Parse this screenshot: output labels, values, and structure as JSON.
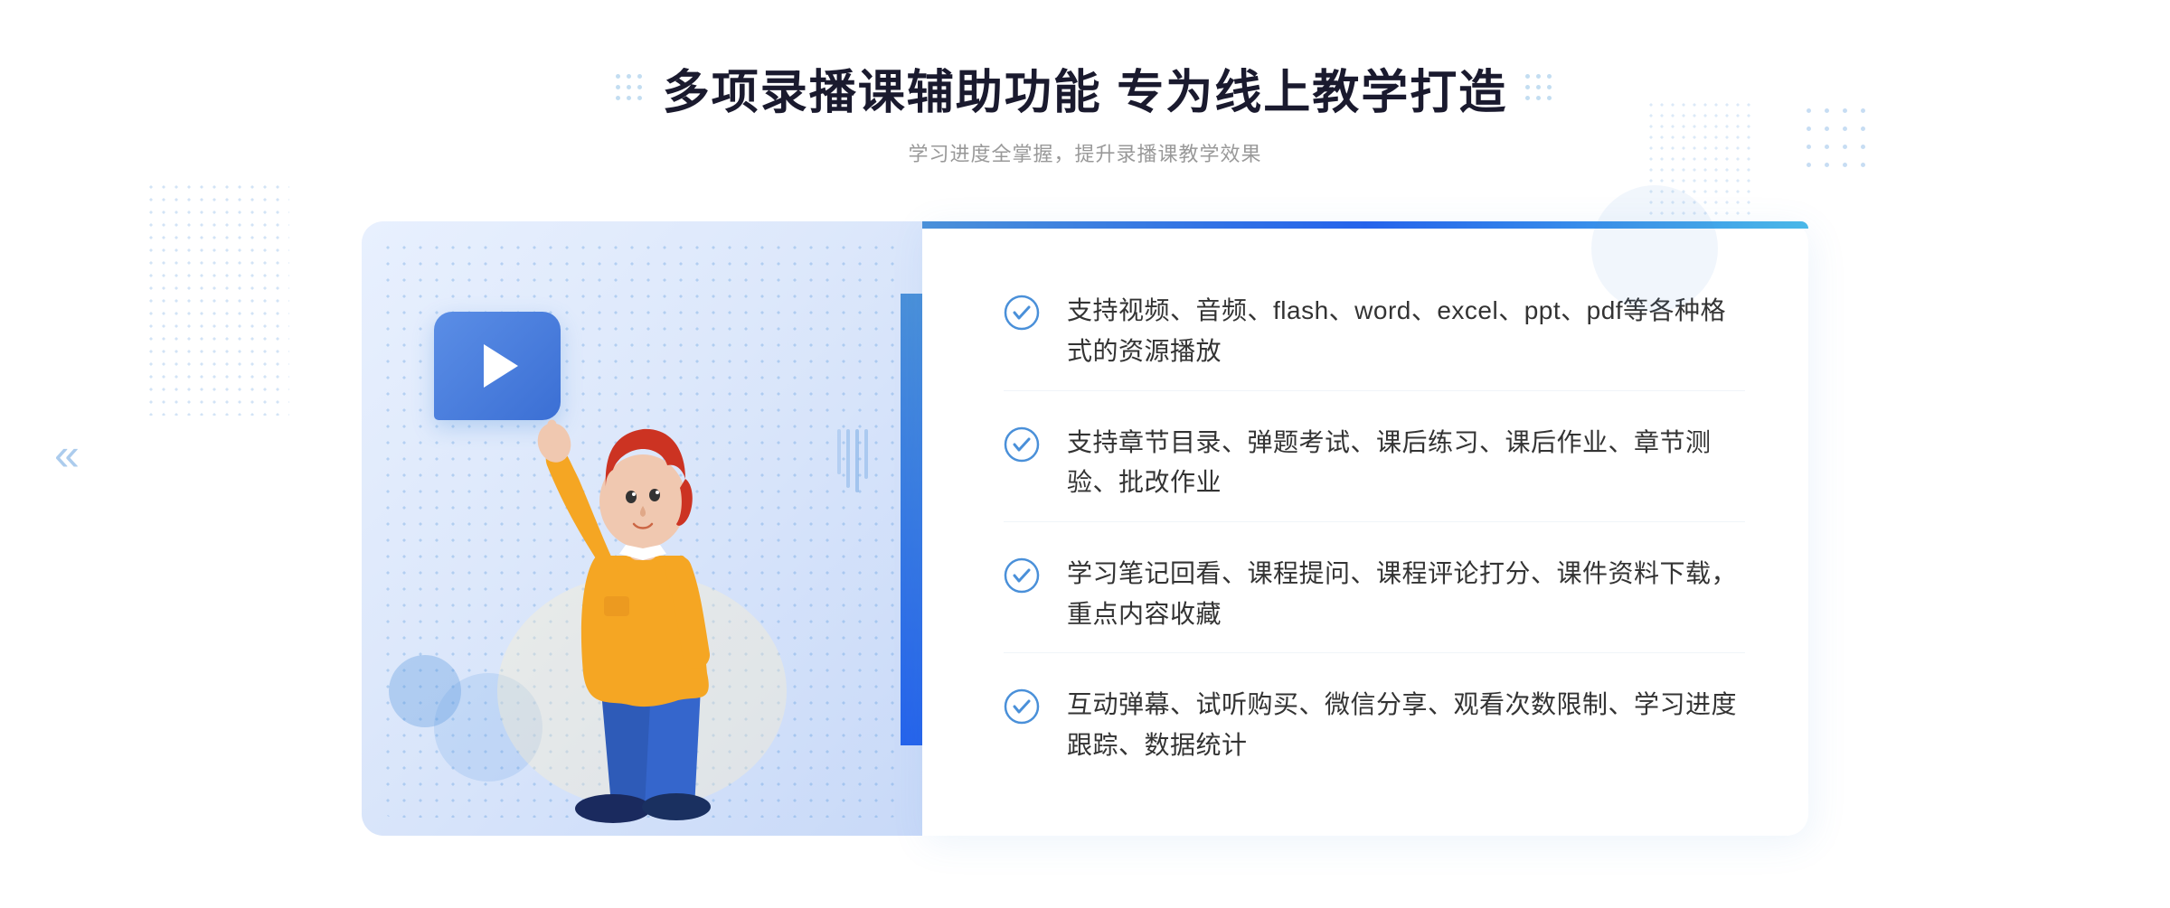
{
  "header": {
    "title": "多项录播课辅助功能 专为线上教学打造",
    "subtitle": "学习进度全掌握，提升录播课教学效果"
  },
  "features": [
    {
      "id": "feature-1",
      "text": "支持视频、音频、flash、word、excel、ppt、pdf等各种格式的资源播放"
    },
    {
      "id": "feature-2",
      "text": "支持章节目录、弹题考试、课后练习、课后作业、章节测验、批改作业"
    },
    {
      "id": "feature-3",
      "text": "学习笔记回看、课程提问、课程评论打分、课件资料下载，重点内容收藏"
    },
    {
      "id": "feature-4",
      "text": "互动弹幕、试听购买、微信分享、观看次数限制、学习进度跟踪、数据统计"
    }
  ],
  "decorations": {
    "left_chevrons": "«",
    "dots_label": "decorative-dots"
  }
}
